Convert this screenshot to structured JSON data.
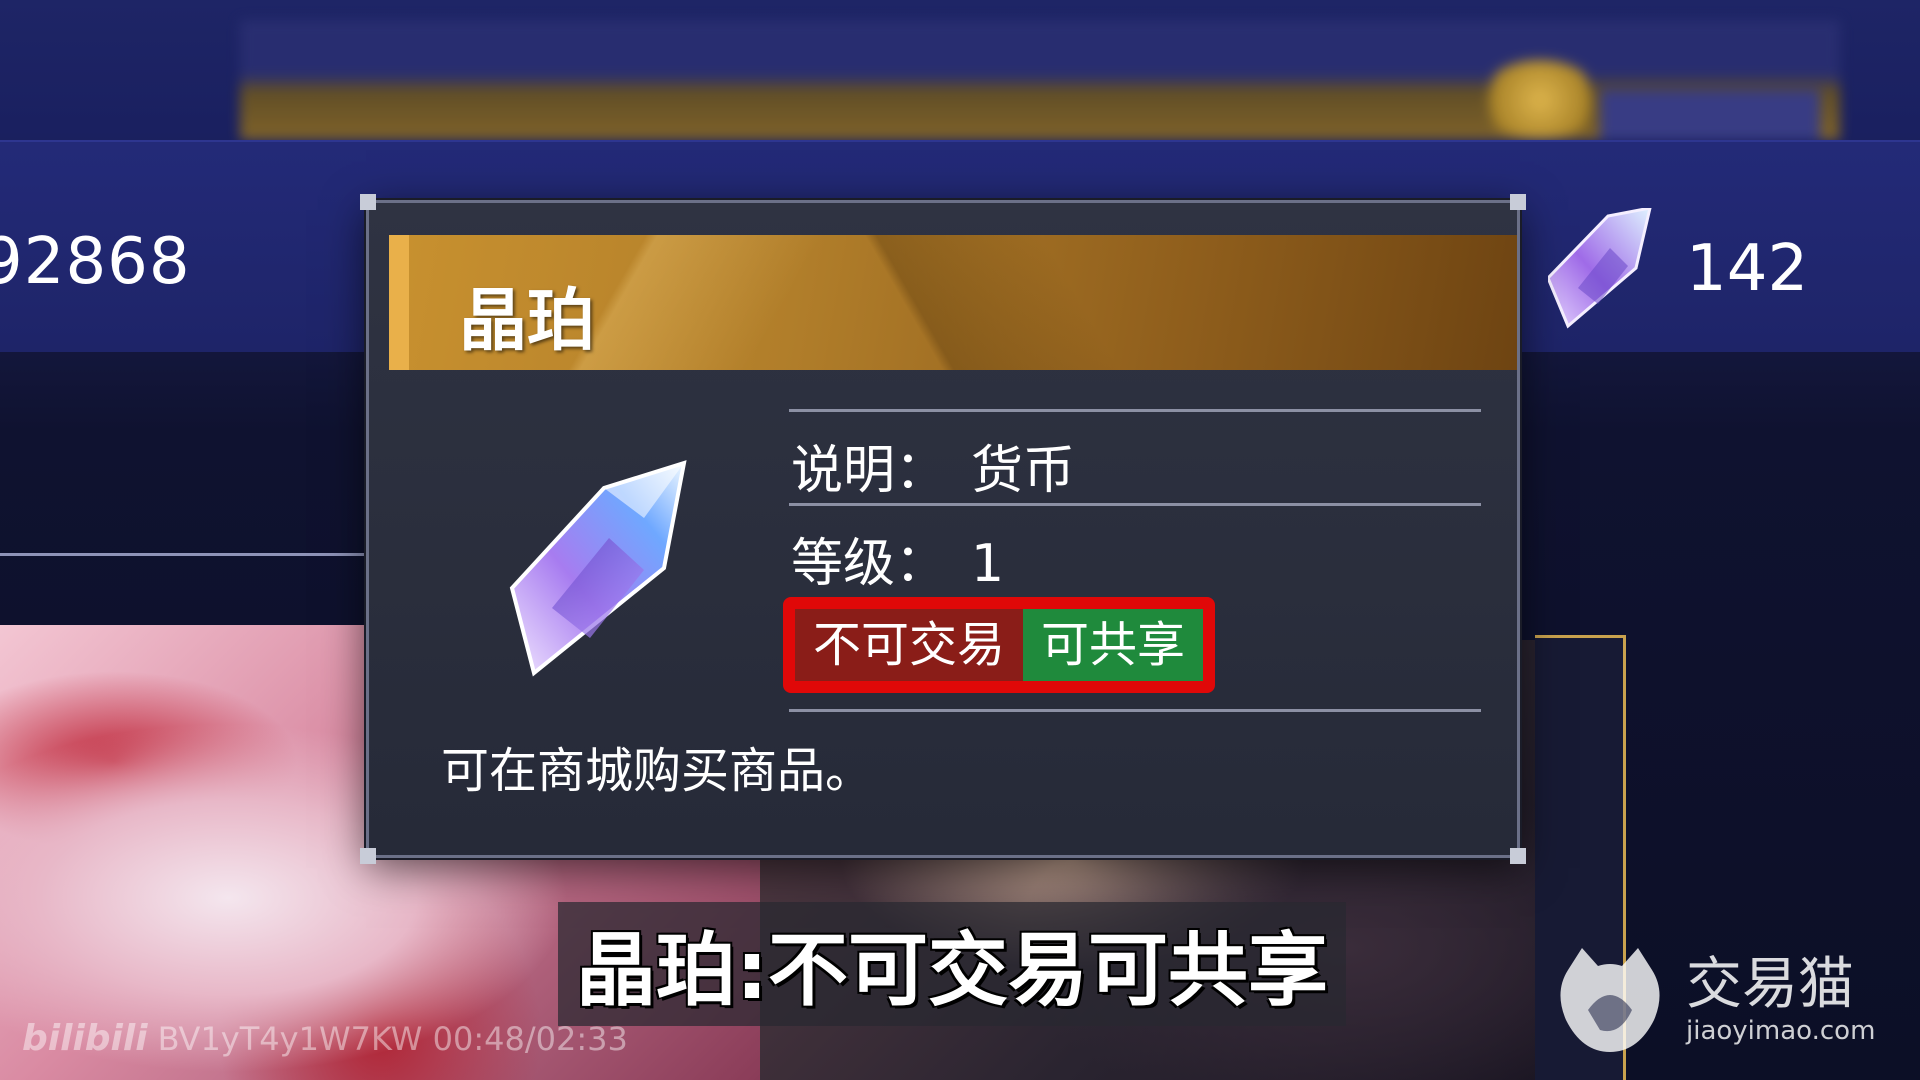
{
  "header": {
    "gold_amount": "92868",
    "crystal_amount": "142"
  },
  "popup": {
    "title": "晶珀",
    "description_label": "说明：",
    "description_value": "货币",
    "level_label": "等级：",
    "level_value": "1",
    "tags": {
      "not_tradeable": "不可交易",
      "shareable": "可共享"
    },
    "flavor_text": "可在商城购买商品。"
  },
  "subtitle": "晶珀:不可交易可共享",
  "watermarks": {
    "bilibili_logo": "bilibili",
    "bilibili_code": "BV1yT4y1W7KW 00:48/02:33",
    "site_name_cn": "交易猫",
    "site_name_en": "jiaoyimao.com"
  },
  "colors": {
    "tag_red": "#8a1d18",
    "tag_green": "#1f8a3c",
    "highlight_border": "#e00808",
    "header_gold": "#c7902f"
  },
  "icons": {
    "crystal": "crystal-icon",
    "watermark_cat": "cat-logo-icon"
  }
}
